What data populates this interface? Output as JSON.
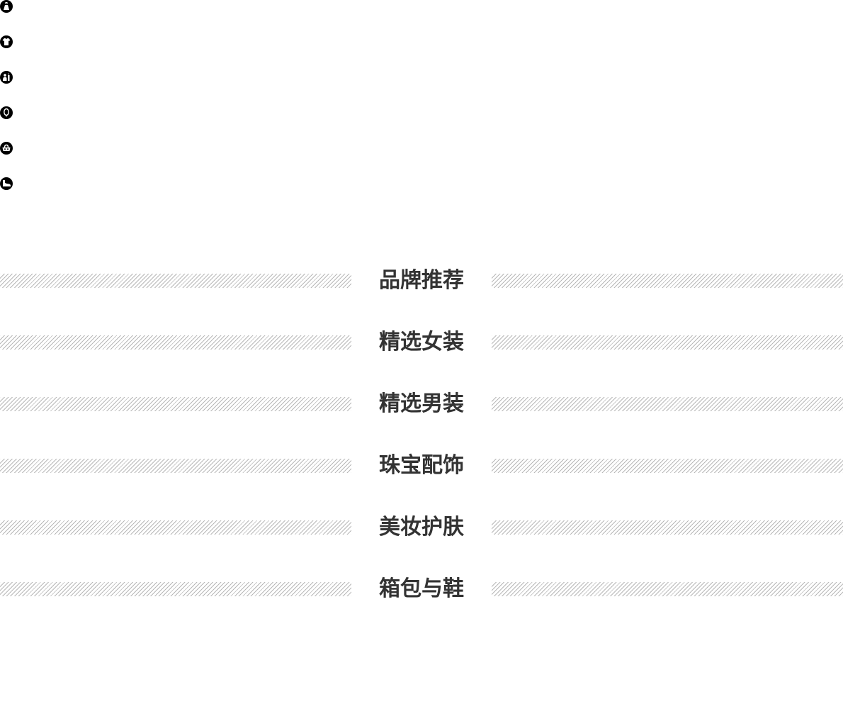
{
  "floor_nav": {
    "icons": [
      {
        "icon": "dress-icon"
      },
      {
        "icon": "tshirt-icon"
      },
      {
        "icon": "ring-icon"
      },
      {
        "icon": "gem-icon"
      },
      {
        "icon": "bag-icon"
      },
      {
        "icon": "shoe-icon"
      }
    ]
  },
  "sections": [
    {
      "title": "品牌推荐"
    },
    {
      "title": "精选女装"
    },
    {
      "title": "精选男装"
    },
    {
      "title": "珠宝配饰"
    },
    {
      "title": "美妆护肤"
    },
    {
      "title": "箱包与鞋"
    }
  ],
  "colors": {
    "title_text": "#333333",
    "stripe": "#b8b8b8",
    "icon": "#000000"
  }
}
